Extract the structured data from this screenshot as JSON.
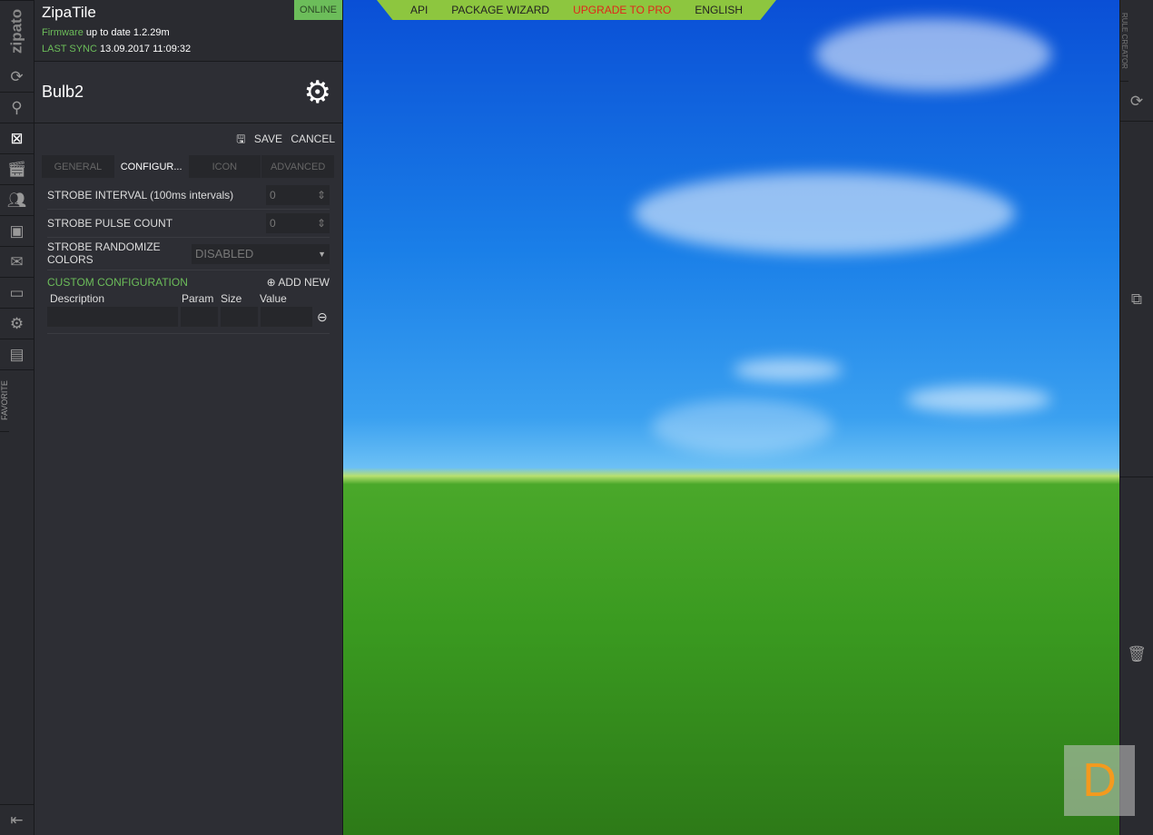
{
  "header": {
    "app_title": "ZipaTile",
    "status": "ONLINE",
    "firmware_label": "Firmware",
    "firmware_value": "up to date 1.2.29m",
    "sync_label": "LAST SYNC",
    "sync_value": "13.09.2017 11:09:32"
  },
  "logo": "zipato",
  "sidebar": {
    "favorite": "FAVORITE"
  },
  "device": {
    "name": "Bulb2"
  },
  "actions": {
    "save": "SAVE",
    "cancel": "CANCEL"
  },
  "tabs": [
    "GENERAL",
    "CONFIGUR...",
    "ICON",
    "ADVANCED"
  ],
  "config": [
    {
      "label": "STROBE INTERVAL (100ms intervals)",
      "value": "0"
    },
    {
      "label": "STROBE PULSE COUNT",
      "value": "0"
    },
    {
      "label": "STROBE RANDOMIZE COLORS",
      "value": "DISABLED"
    }
  ],
  "custom": {
    "title": "CUSTOM CONFIGURATION",
    "add": "ADD NEW",
    "columns": [
      "Description",
      "Param",
      "Size",
      "Value"
    ]
  },
  "topnav": [
    "API",
    "PACKAGE WIZARD",
    "UPGRADE TO PRO",
    "ENGLISH"
  ],
  "rightbar": {
    "rule_creator": "RULE CREATOR"
  },
  "badge": "D",
  "colors": {
    "accent": "#6cbd5a",
    "nav": "#8dc63f",
    "pro": "#e0261b"
  }
}
